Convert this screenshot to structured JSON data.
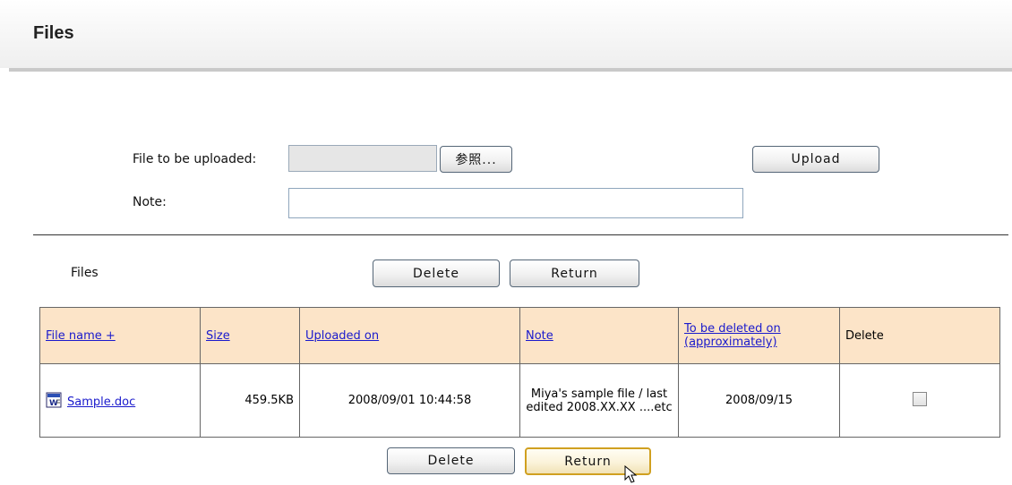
{
  "header": {
    "title": "Files"
  },
  "upload_form": {
    "file_label": "File to be uploaded:",
    "file_value": "",
    "browse_label": "参照...",
    "upload_label": "Upload",
    "note_label": "Note:",
    "note_value": ""
  },
  "files_section": {
    "label": "Files",
    "delete_label": "Delete",
    "return_label": "Return"
  },
  "table": {
    "columns": [
      {
        "label": "File name +"
      },
      {
        "label": "Size"
      },
      {
        "label": "Uploaded on"
      },
      {
        "label": "Note"
      },
      {
        "label": "To be deleted on (approximately)"
      },
      {
        "label": "Delete"
      }
    ],
    "rows": [
      {
        "file_name": "Sample.doc",
        "file_icon": "word-document-icon",
        "size": "459.5KB",
        "uploaded_on": "2008/09/01 10:44:58",
        "note": "Miya's sample file / last edited 2008.XX.XX ....etc",
        "to_be_deleted_on": "2008/09/15",
        "delete_checked": false
      }
    ]
  },
  "colors": {
    "header_row_bg": "#fce4c8",
    "link": "#1a1acc",
    "focused_button_border": "#d0a020"
  }
}
